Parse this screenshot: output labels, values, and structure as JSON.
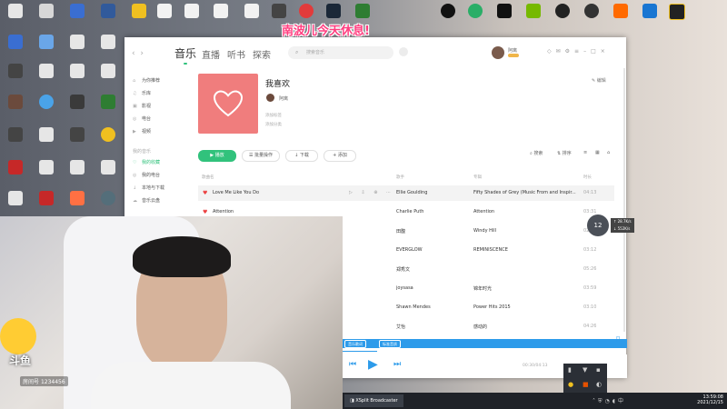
{
  "banner": {
    "text": "南波儿今天休息!"
  },
  "app": {
    "tabs": [
      "音乐",
      "直播",
      "听书",
      "探索"
    ],
    "search_placeholder": "搜索音乐",
    "user_name": "阿离",
    "sidebar": {
      "online": [
        {
          "label": "为你推荐",
          "icon": "home-icon"
        },
        {
          "label": "乐库",
          "icon": "music-library-icon"
        },
        {
          "label": "影视",
          "icon": "video-icon"
        },
        {
          "label": "电台",
          "icon": "radio-icon"
        },
        {
          "label": "视频",
          "icon": "video-icon"
        }
      ],
      "section": "我的音乐",
      "mine": [
        {
          "label": "我的收藏",
          "icon": "heart-icon"
        },
        {
          "label": "我的电台",
          "icon": "radio-icon"
        },
        {
          "label": "本地与下载",
          "icon": "download-icon"
        },
        {
          "label": "音乐云盘",
          "icon": "cloud-icon"
        }
      ]
    },
    "playlist": {
      "title": "我喜欢",
      "owner": "阿离",
      "tags_label": "添加标签",
      "desc_label": "添加分类",
      "edit_label": "编辑"
    },
    "actions": {
      "play": "播放",
      "batch": "批量操作",
      "download": "下载",
      "add": "添加",
      "search": "搜索",
      "sort": "排序"
    },
    "columns": {
      "title": "歌曲名",
      "artist": "歌手",
      "album": "专辑",
      "duration": "时长"
    },
    "songs": [
      {
        "title": "Love Me Like You Do",
        "artist": "Ellie Goulding",
        "album": "Fifty Shades of Grey (Music From and Inspir...",
        "duration": "04:13"
      },
      {
        "title": "Attention",
        "artist": "Charlie Puth",
        "album": "Attention",
        "duration": "03:31"
      },
      {
        "title": "",
        "artist": "田馥",
        "album": "Windy Hill",
        "duration": "02:57"
      },
      {
        "title": "",
        "artist": "EVERGLOW",
        "album": "REMINISCENCE",
        "duration": "03:12"
      },
      {
        "title": "",
        "artist": "郑秀文",
        "album": "",
        "duration": "05:26"
      },
      {
        "title": "",
        "artist": "joysasa",
        "album": "锦年时光",
        "duration": "03:59"
      },
      {
        "title": "",
        "artist": "Shawn Mendes",
        "album": "Power Hits 2015",
        "duration": "03:10"
      },
      {
        "title": "",
        "artist": "艾怡",
        "album": "感动的",
        "duration": "04:26"
      }
    ],
    "player": {
      "lyrics_btn": "音乐歌词",
      "quality_btn": "标准音质",
      "time": "00:30/04:13",
      "progress": 0.12
    }
  },
  "overlay": {
    "perf_value": "12",
    "perf_up": "28.7K/s",
    "perf_down": "552K/s",
    "douyu_logo": "斗鱼",
    "room_label": "房间号",
    "room_id": "1234456"
  },
  "taskbar": {
    "app_label": "XSplit Broadcaster",
    "time": "13:59:08",
    "date": "2021/12/15"
  },
  "colors": {
    "accent": "#31c27c",
    "cover": "#f07d7d",
    "heart": "#ec4141",
    "player": "#2d9bea",
    "banner": "#ff3d7f"
  }
}
